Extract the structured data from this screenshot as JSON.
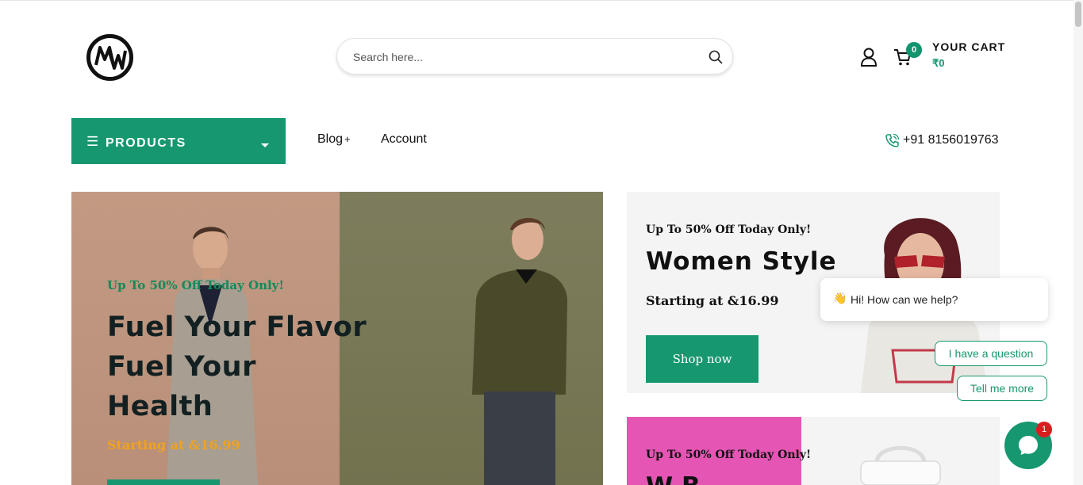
{
  "header": {
    "logo_text": "MW",
    "search_placeholder": "Search here...",
    "cart": {
      "count": "0",
      "title": "YOUR CART",
      "total": "₹0"
    }
  },
  "nav": {
    "products_label": "PRODUCTS",
    "items": [
      {
        "label": "Blog",
        "suffix": "+"
      },
      {
        "label": "Account"
      }
    ],
    "phone": "+91 8156019763"
  },
  "hero": {
    "tag": "Up To 50% Off Today Only!",
    "title": "Fuel Your Flavor Fuel Your Health",
    "price": "Starting at &16.99"
  },
  "promo1": {
    "tag": "Up To 50% Off Today Only!",
    "title": "Women Style",
    "price": "Starting at &16.99",
    "button": "Shop now"
  },
  "promo2": {
    "tag": "Up To 50% Off Today Only!",
    "partial_title": "W          B"
  },
  "chat": {
    "greeting": "Hi! How can we help?",
    "options": [
      "I have a question",
      "Tell me more"
    ],
    "unread": "1"
  },
  "colors": {
    "accent": "#16976f",
    "price": "#f2a21c",
    "badge": "#d81e1e"
  }
}
